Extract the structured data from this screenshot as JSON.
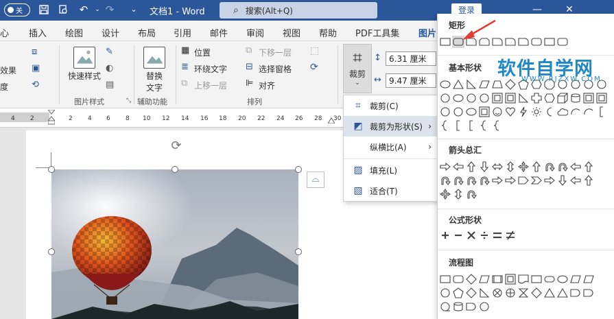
{
  "titlebar": {
    "autosave_label": "关",
    "doc_title": "文档1 - Word",
    "search_placeholder": "搜索(Alt+Q)",
    "login_label": "登录",
    "min_label": "—",
    "max_label": "☐",
    "close_label": "✕"
  },
  "tabs": [
    "心",
    "插入",
    "绘图",
    "设计",
    "布局",
    "引用",
    "邮件",
    "审阅",
    "视图",
    "帮助",
    "PDF工具集",
    "图片"
  ],
  "ribbon": {
    "left_labels": [
      "效果",
      "度"
    ],
    "quick_style_label": "快速样式",
    "picture_style_group": "图片样式",
    "alt_text_label_1": "替换",
    "alt_text_label_2": "文字",
    "accessibility_group": "辅助功能",
    "position_label": "位置",
    "wrap_text_label": "环绕文字",
    "bring_forward_label": "上移一层",
    "send_backward_label": "下移一层",
    "selection_pane_label": "选择窗格",
    "align_label": "对齐",
    "arrange_group": "排列",
    "crop_label": "裁剪",
    "height_value": "6.31 厘米",
    "width_value": "9.47 厘米"
  },
  "ruler_numbers": [
    "4",
    "2",
    "",
    "2",
    "4",
    "6",
    "8",
    "10",
    "12",
    "14",
    "16",
    "18",
    "20",
    "22",
    "24",
    "26",
    "28",
    "30",
    "32",
    "34",
    "36",
    "38"
  ],
  "crop_menu": [
    {
      "label": "裁剪(C)",
      "icon": "crop-icon",
      "arrow": ""
    },
    {
      "label": "裁剪为形状(S)",
      "icon": "crop-to-shape-icon",
      "arrow": "›"
    },
    {
      "label": "纵横比(A)",
      "icon": "",
      "arrow": "›"
    },
    {
      "label": "填充(L)",
      "icon": "fill-icon",
      "arrow": ""
    },
    {
      "label": "适合(T)",
      "icon": "fit-icon",
      "arrow": ""
    }
  ],
  "shape_panel": {
    "sections": [
      "矩形",
      "基本形状",
      "箭头总汇",
      "公式形状",
      "流程图"
    ]
  },
  "watermark": {
    "text": "软件自学网",
    "url": "WWW.RJZXW.COM"
  },
  "colors": {
    "titlebar": "#2b579a",
    "accent": "#2b579a",
    "watermark": "#1e88c8",
    "annotation_arrow": "#e53935"
  }
}
